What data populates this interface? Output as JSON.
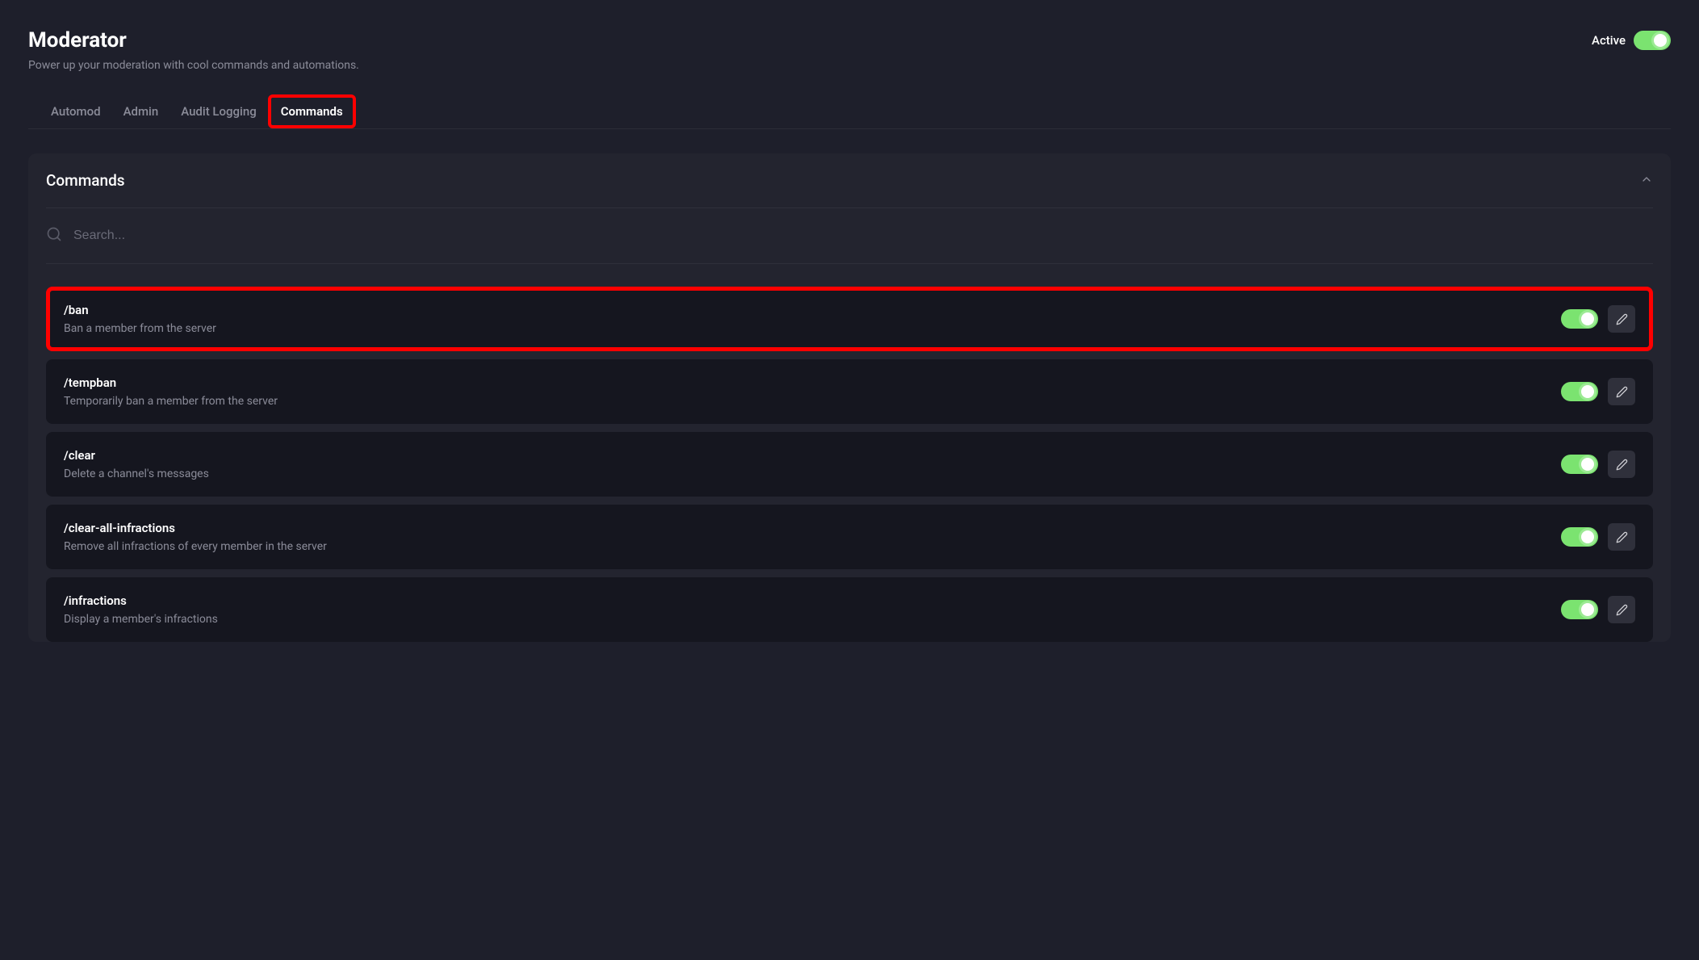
{
  "header": {
    "title": "Moderator",
    "subtitle": "Power up your moderation with cool commands and automations.",
    "active_label": "Active"
  },
  "tabs": {
    "items": [
      {
        "label": "Automod",
        "active": false
      },
      {
        "label": "Admin",
        "active": false
      },
      {
        "label": "Audit Logging",
        "active": false
      },
      {
        "label": "Commands",
        "active": true,
        "highlighted": true
      }
    ]
  },
  "panel": {
    "title": "Commands",
    "search_placeholder": "Search..."
  },
  "commands": [
    {
      "name": "/ban",
      "desc": "Ban a member from the server",
      "enabled": true,
      "highlighted": true
    },
    {
      "name": "/tempban",
      "desc": "Temporarily ban a member from the server",
      "enabled": true
    },
    {
      "name": "/clear",
      "desc": "Delete a channel's messages",
      "enabled": true
    },
    {
      "name": "/clear-all-infractions",
      "desc": "Remove all infractions of every member in the server",
      "enabled": true
    },
    {
      "name": "/infractions",
      "desc": "Display a member's infractions",
      "enabled": true
    }
  ]
}
